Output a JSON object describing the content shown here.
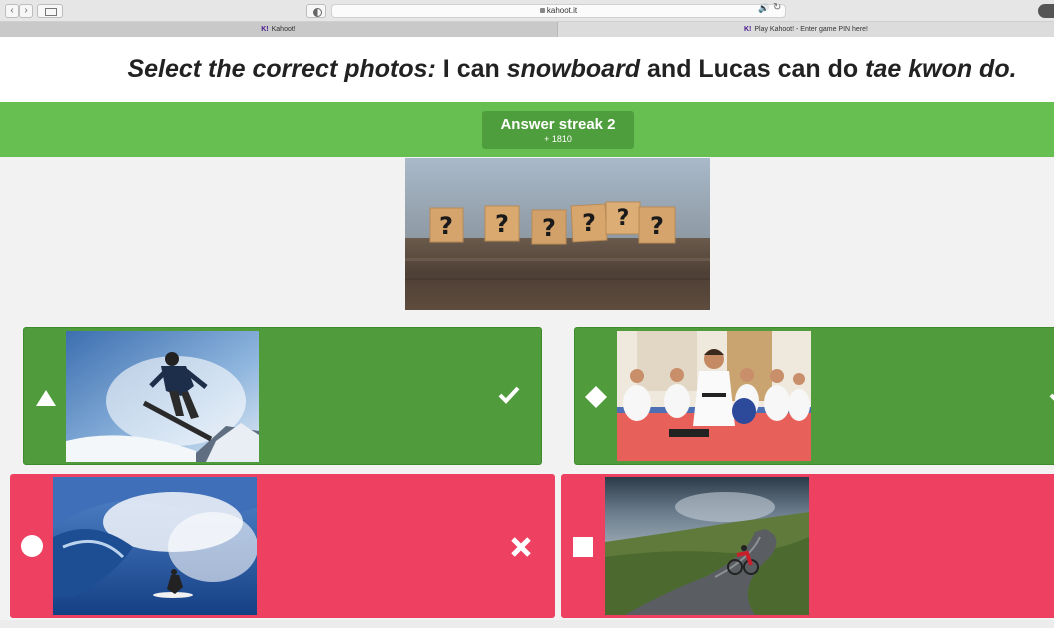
{
  "browser": {
    "url": "kahoot.it",
    "tabs": [
      {
        "label": "Kahoot!",
        "logo": "K!"
      },
      {
        "label": "Play Kahoot! - Enter game PIN here!",
        "logo": "K!"
      }
    ]
  },
  "question": {
    "parts": [
      {
        "text": "Select the correct photos:",
        "style": "italic"
      },
      {
        "text": " I can ",
        "style": "normal"
      },
      {
        "text": "snowboard",
        "style": "italic"
      },
      {
        "text": " and Lucas can do ",
        "style": "normal"
      },
      {
        "text": "tae kwon do.",
        "style": "italic"
      }
    ]
  },
  "streak": {
    "title": "Answer streak 2",
    "points": "+ 1810"
  },
  "question_image": {
    "icon": "question-mark-cubes-image",
    "glyph": "?"
  },
  "answers": [
    {
      "shape": "triangle-icon",
      "photo": "snowboarder-photo",
      "color": "#509b3b",
      "result": "correct",
      "result_icon": "checkmark-icon"
    },
    {
      "shape": "diamond-icon",
      "photo": "taekwondo-kids-photo",
      "color": "#509b3b",
      "result": "correct",
      "result_icon": "checkmark-icon"
    },
    {
      "shape": "circle-icon",
      "photo": "surfer-photo",
      "color": "#ee4061",
      "result": "incorrect",
      "result_icon": "cross-icon"
    },
    {
      "shape": "square-icon",
      "photo": "cyclist-photo",
      "color": "#ee4061",
      "result": "none",
      "result_icon": ""
    }
  ],
  "colors": {
    "streak_green": "#66bf50",
    "answer_green": "#509b3b",
    "answer_red": "#ee4061",
    "kahoot_purple": "#46178f"
  }
}
